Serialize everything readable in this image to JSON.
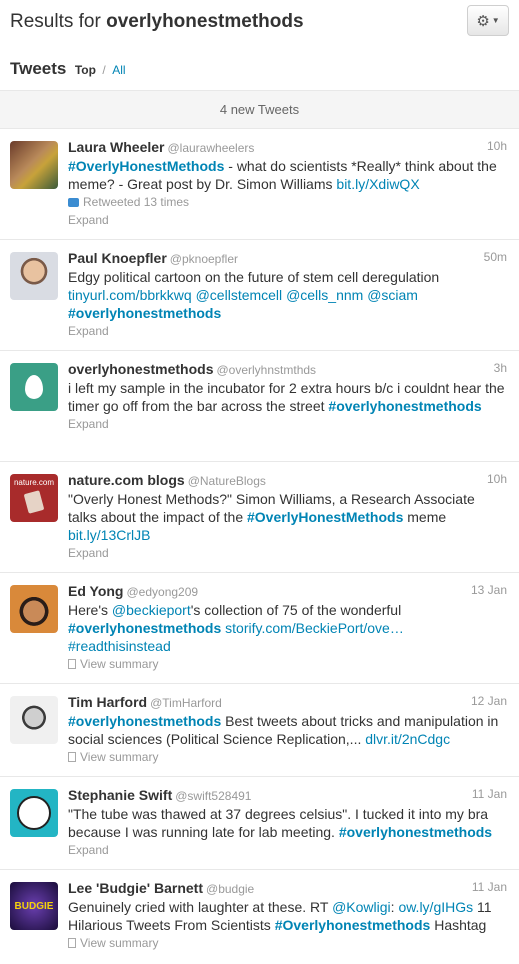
{
  "header": {
    "results_prefix": "Results for",
    "query": "overlyhonestmethods",
    "gear_icon": "gear-icon",
    "tweets_label": "Tweets",
    "filter_top": "Top",
    "filter_sep": "/",
    "filter_all": "All"
  },
  "new_tweets": "4 new Tweets",
  "tweets": [
    {
      "name": "Laura Wheeler",
      "handle": "@laurawheelers",
      "time": "10h",
      "text": [
        {
          "t": "tag",
          "v": "#OverlyHonestMethods"
        },
        {
          "t": "plain",
          "v": " - what do scientists *Really* think about the meme? - Great post by Dr. Simon Williams "
        },
        {
          "t": "link",
          "v": "bit.ly/XdiwQX"
        }
      ],
      "retweeted": "Retweeted 13 times",
      "action": "Expand"
    },
    {
      "name": "Paul Knoepfler",
      "handle": "@pknoepfler",
      "time": "50m",
      "text": [
        {
          "t": "plain",
          "v": "Edgy political cartoon on the future of stem cell deregulation "
        },
        {
          "t": "link",
          "v": "tinyurl.com/bbrkkwq"
        },
        {
          "t": "plain",
          "v": " "
        },
        {
          "t": "link",
          "v": "@cellstemcell"
        },
        {
          "t": "plain",
          "v": " "
        },
        {
          "t": "link",
          "v": "@cells_nnm"
        },
        {
          "t": "plain",
          "v": " "
        },
        {
          "t": "link",
          "v": "@sciam"
        },
        {
          "t": "plain",
          "v": " "
        },
        {
          "t": "tag",
          "v": "#overlyhonestmethods"
        }
      ],
      "action": "Expand"
    },
    {
      "name": "overlyhonestmethods",
      "handle": "@overlyhnstmthds",
      "time": "3h",
      "text": [
        {
          "t": "plain",
          "v": "i left my sample in the incubator for 2 extra hours b/c i couldnt hear the timer go off from the bar across the street "
        },
        {
          "t": "tag",
          "v": "#overlyhonestmethods"
        }
      ],
      "action": "Expand"
    },
    {
      "name": "nature.com blogs",
      "handle": "@NatureBlogs",
      "time": "10h",
      "avatar_text": "nature.com",
      "text": [
        {
          "t": "plain",
          "v": "\"Overly Honest Methods?\" Simon Williams, a Research Associate talks about the impact of the "
        },
        {
          "t": "tag",
          "v": "#OverlyHonestMethods"
        },
        {
          "t": "plain",
          "v": " meme "
        },
        {
          "t": "link",
          "v": "bit.ly/13CrlJB"
        }
      ],
      "action": "Expand"
    },
    {
      "name": "Ed Yong",
      "handle": "@edyong209",
      "time": "13 Jan",
      "text": [
        {
          "t": "plain",
          "v": "Here's "
        },
        {
          "t": "link",
          "v": "@beckieport"
        },
        {
          "t": "plain",
          "v": "'s collection of 75 of the wonderful "
        },
        {
          "t": "tag",
          "v": "#overlyhonestmethods"
        },
        {
          "t": "plain",
          "v": " "
        },
        {
          "t": "link",
          "v": "storify.com/BeckiePort/ove…"
        },
        {
          "t": "plain",
          "v": " "
        },
        {
          "t": "link",
          "v": "#readthisinstead"
        }
      ],
      "summary": "View summary",
      "action": ""
    },
    {
      "name": "Tim Harford",
      "handle": "@TimHarford",
      "time": "12 Jan",
      "text": [
        {
          "t": "tag",
          "v": "#overlyhonestmethods"
        },
        {
          "t": "plain",
          "v": " Best tweets about tricks and manipulation in social sciences (Political Science Replication,... "
        },
        {
          "t": "link",
          "v": "dlvr.it/2nCdgc"
        }
      ],
      "summary": "View summary",
      "action": ""
    },
    {
      "name": "Stephanie Swift",
      "handle": "@swift528491",
      "time": "11 Jan",
      "text": [
        {
          "t": "plain",
          "v": "\"The tube was thawed at 37 degrees celsius\". I tucked it into my bra because I was running late for lab meeting. "
        },
        {
          "t": "tag",
          "v": "#overlyhonestmethods"
        }
      ],
      "action": "Expand"
    },
    {
      "name": "Lee 'Budgie' Barnett",
      "handle": "@budgie",
      "time": "11 Jan",
      "avatar_text": "BUDGIE",
      "text": [
        {
          "t": "plain",
          "v": "Genuinely cried with laughter at these. RT "
        },
        {
          "t": "link",
          "v": "@Kowligi"
        },
        {
          "t": "plain",
          "v": ": "
        },
        {
          "t": "link",
          "v": "ow.ly/gIHGs"
        },
        {
          "t": "plain",
          "v": " 11 Hilarious Tweets From Scientists "
        },
        {
          "t": "tag",
          "v": "#Overlyhonestmethods"
        },
        {
          "t": "plain",
          "v": " Hashtag"
        }
      ],
      "summary": "View summary",
      "action": ""
    }
  ]
}
